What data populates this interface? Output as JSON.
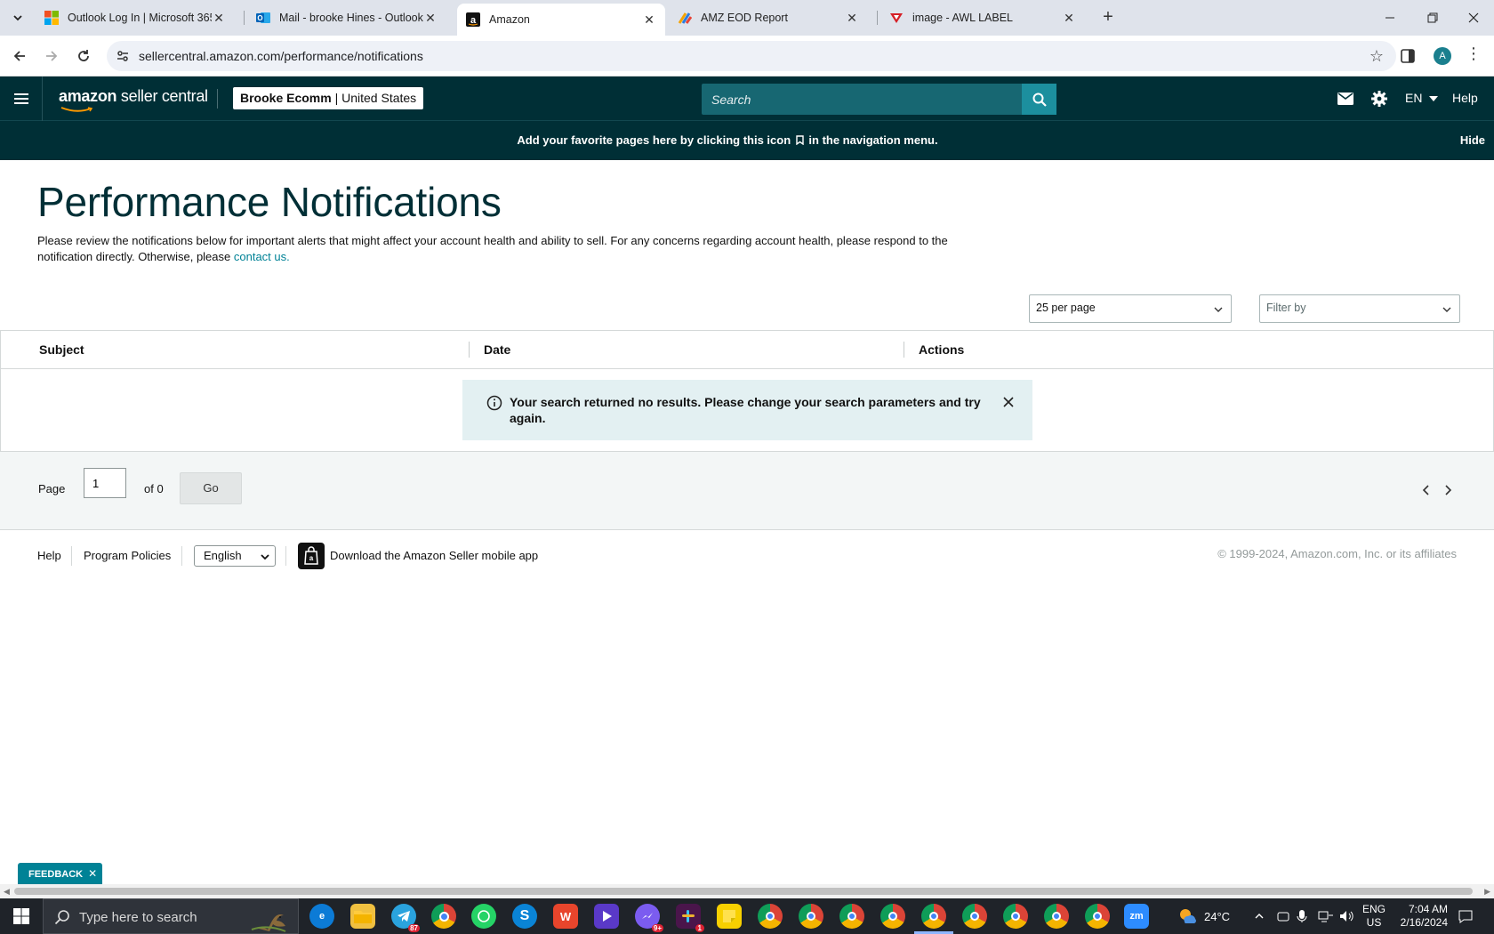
{
  "browser": {
    "tabs": [
      {
        "label": "Outlook Log In | Microsoft 365",
        "icon": "microsoft-icon",
        "active": false
      },
      {
        "label": "Mail - brooke Hines - Outlook",
        "icon": "outlook-icon",
        "active": false
      },
      {
        "label": "Amazon",
        "icon": "amazon-icon",
        "active": true
      },
      {
        "label": "AMZ EOD Report",
        "icon": "report-icon",
        "active": false
      },
      {
        "label": "image - AWL LABEL",
        "icon": "label-icon",
        "active": false
      }
    ],
    "url": "sellercentral.amazon.com/performance/notifications",
    "profile_initial": "A"
  },
  "header": {
    "logo_bold": "amazon",
    "logo_light": " seller central",
    "account_name": "Brooke Ecomm",
    "account_sep": " | ",
    "account_region": "United States",
    "search_placeholder": "Search",
    "language": "EN",
    "help": "Help"
  },
  "favorites_banner": {
    "message_before": "Add your favorite pages here by clicking this icon",
    "message_after": "in the navigation menu.",
    "hide": "Hide"
  },
  "main": {
    "title": "Performance Notifications",
    "description": "Please review the notifications below for important alerts that might affect your account health and ability to sell. For any concerns regarding account health, please respond to the notification directly. Otherwise, please",
    "contact_link": "contact us.",
    "per_page": "25 per page",
    "filter_placeholder": "Filter by",
    "columns": [
      "Subject",
      "Date",
      "Actions"
    ],
    "no_results": "Your search returned no results. Please change your search parameters and try again."
  },
  "pager": {
    "page_label": "Page",
    "page_value": "1",
    "of_label": "of 0",
    "go": "Go"
  },
  "footer": {
    "help": "Help",
    "program_policies": "Program Policies",
    "language": "English",
    "app": "Download the Amazon Seller mobile app",
    "copyright": "© 1999-2024, Amazon.com, Inc. or its affiliates"
  },
  "feedback": {
    "label": "FEEDBACK"
  },
  "taskbar": {
    "search_placeholder": "Type here to search",
    "weather": "24°C",
    "lang_top": "ENG",
    "lang_bottom": "US",
    "time": "7:04 AM",
    "date": "2/16/2024",
    "telegram_badge": "87",
    "messenger_badge": "9+",
    "slack_badge": "1"
  },
  "colors": {
    "header_bg": "#002f36",
    "accent": "#008296",
    "search_btn": "#1c8f9e"
  }
}
